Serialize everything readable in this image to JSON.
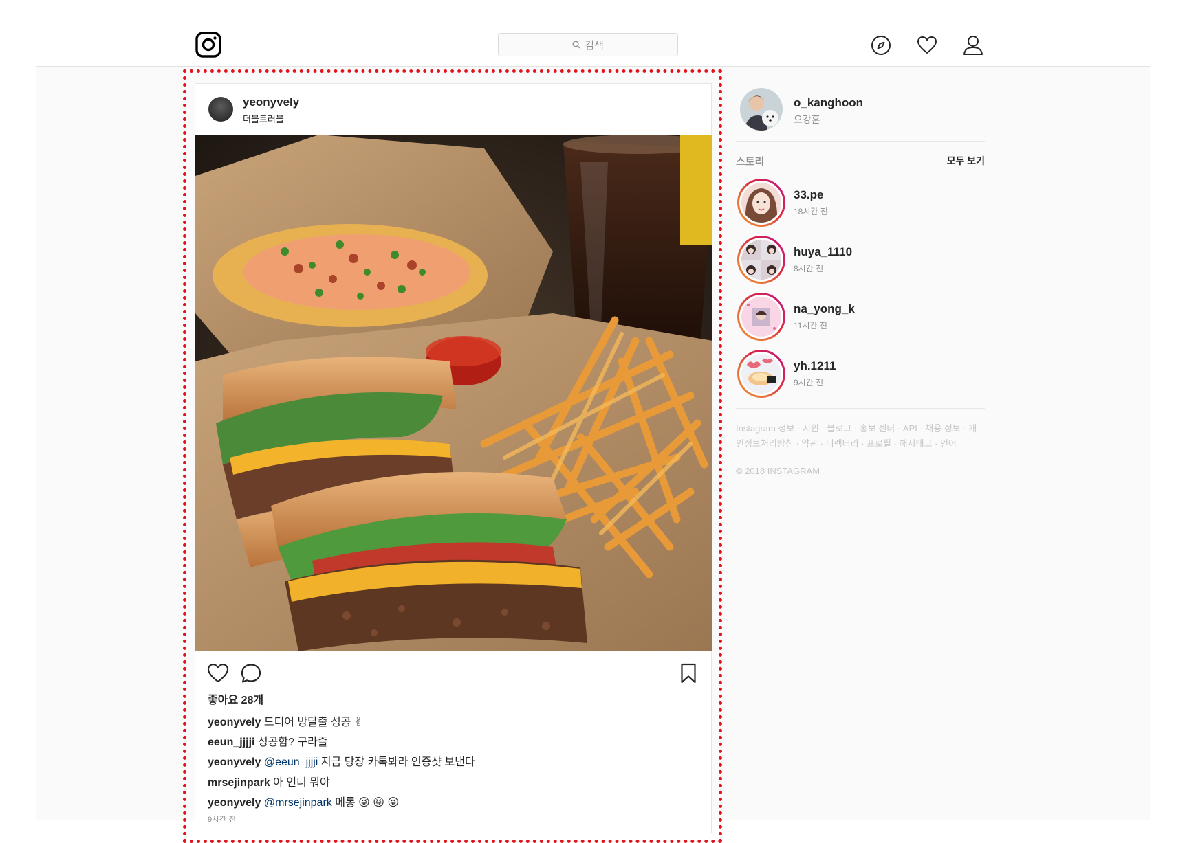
{
  "header": {
    "logo_icon": "instagram-camera-icon",
    "search_placeholder": "검색",
    "nav_icons": [
      "compass-icon",
      "heart-icon",
      "profile-icon"
    ]
  },
  "post": {
    "username": "yeonyvely",
    "location": "더블트러블",
    "photo_alt": "burger-and-fries-photo",
    "likes": "좋아요 28개",
    "comments": [
      {
        "user": "yeonyvely",
        "mention": "",
        "text": "드디어 방탈출 성공 ✌"
      },
      {
        "user": "eeun_jjjji",
        "mention": "",
        "text": "성공함? 구라즐"
      },
      {
        "user": "yeonyvely",
        "mention": "@eeun_jjjji",
        "text": "지금 당장 카톡봐라 인증샷 보낸다"
      },
      {
        "user": "mrsejinpark",
        "mention": "",
        "text": "아 언니 뭐야"
      },
      {
        "user": "yeonyvely",
        "mention": "@mrsejinpark",
        "text": "메롱 😜 😝 😜"
      }
    ],
    "time": "9시간 전"
  },
  "sidebar": {
    "me": {
      "username": "o_kanghoon",
      "name": "오강훈"
    },
    "stories_title": "스토리",
    "stories_all": "모두 보기",
    "stories": [
      {
        "username": "33.pe",
        "time": "18시간 전"
      },
      {
        "username": "huya_1110",
        "time": "8시간 전"
      },
      {
        "username": "na_yong_k",
        "time": "11시간 전"
      },
      {
        "username": "yh.1211",
        "time": "9시간 전"
      }
    ],
    "footer_links": "Instagram 정보 · 지원 · 블로그 · 홍보 센터 · API · 채용 정보 · 개인정보처리방침 · 약관 · 디렉터리 · 프로필 · 해시태그 · 언어",
    "copyright": "© 2018 INSTAGRAM"
  },
  "colors": {
    "accent_ring": "#dc2743",
    "mention": "#003569",
    "highlight": "#e1141c"
  }
}
